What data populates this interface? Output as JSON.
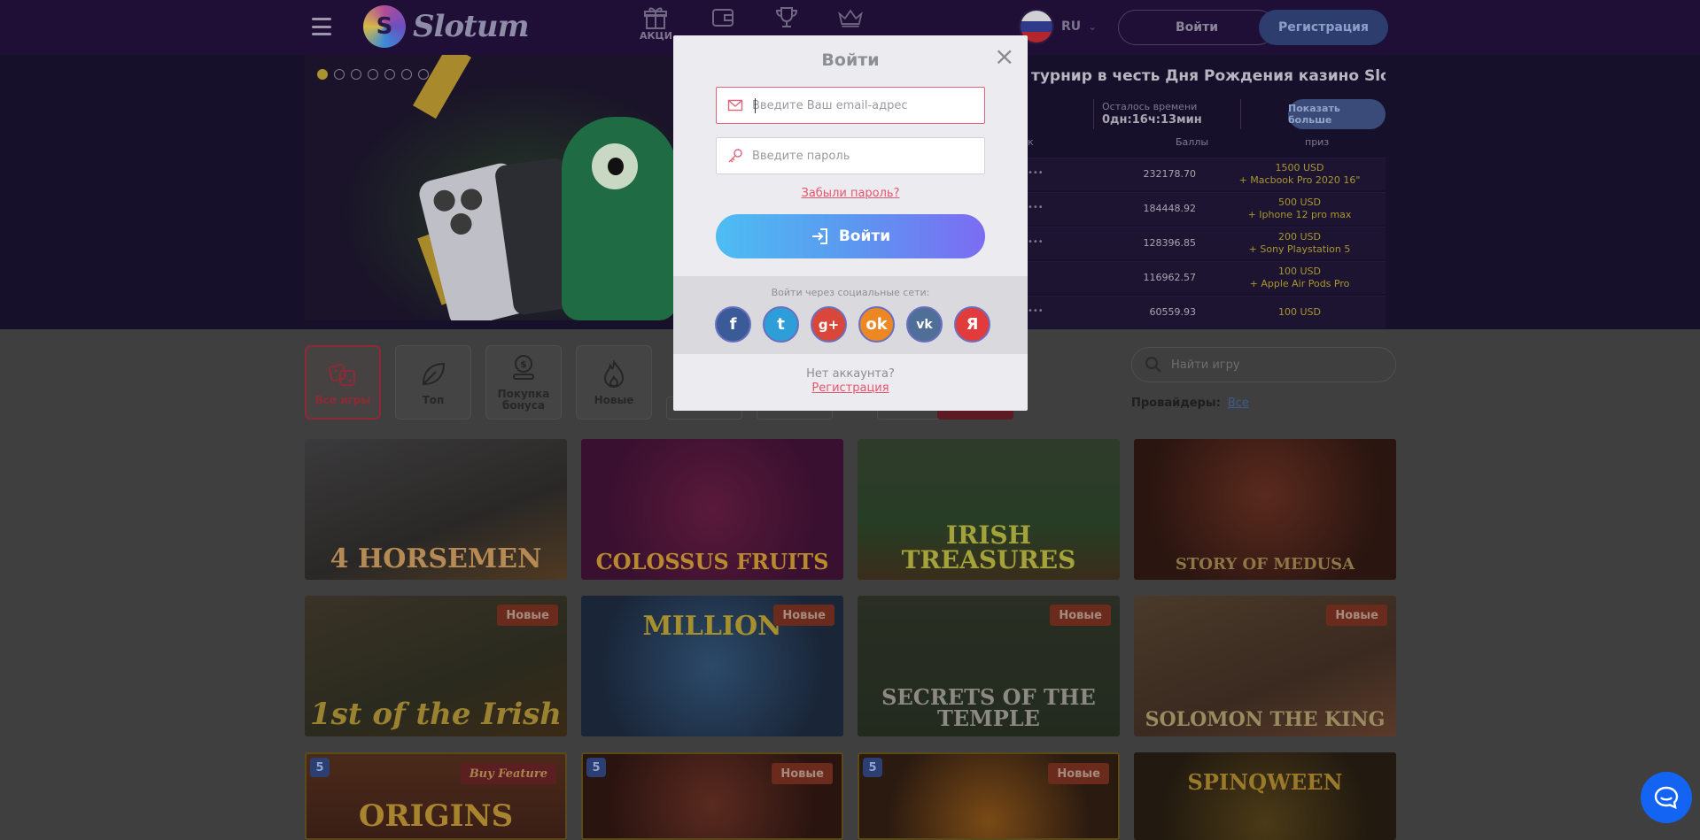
{
  "header": {
    "logo_text": "Slotum",
    "nav": [
      {
        "label": "АКЦИ",
        "icon": "gift-icon"
      },
      {
        "label": "",
        "icon": "wallet-icon"
      },
      {
        "label": "",
        "icon": "trophy-icon"
      },
      {
        "label": "",
        "icon": "crown-icon"
      }
    ],
    "lang": "RU",
    "login_label": "Войти",
    "register_label": "Регистрация"
  },
  "tournament": {
    "title": "вый турнир в честь Дня Рождения казино Slotum!",
    "time_label": "Осталось времени",
    "time_value": "0дн:16ч:13мин",
    "more_label": "Показать больше",
    "col_place": "к",
    "col_points": "Баллы",
    "col_prize": "приз",
    "rows": [
      {
        "player": "•••",
        "points": "232178.70",
        "prize": "1500 USD",
        "prize_extra": "+ Macbook Pro 2020 16\""
      },
      {
        "player": "•••",
        "points": "184448.92",
        "prize": "500 USD",
        "prize_extra": "+ Iphone 12 pro max"
      },
      {
        "player": "•••",
        "points": "128396.85",
        "prize": "200 USD",
        "prize_extra": "+ Sony Playstation 5"
      },
      {
        "player": "",
        "points": "116962.57",
        "prize": "100 USD",
        "prize_extra": "+ Apple Air Pods Pro"
      },
      {
        "player": "•••",
        "points": "60559.93",
        "prize": "100 USD",
        "prize_extra": ""
      }
    ]
  },
  "categories": [
    {
      "label": "Все игры",
      "icon": "dice-icon"
    },
    {
      "label": "Топ",
      "icon": "leaf-icon"
    },
    {
      "label": "Покупка бонуса",
      "icon": "coins-icon"
    },
    {
      "label": "Новые",
      "icon": "fire-icon"
    }
  ],
  "search": {
    "placeholder": "Найти игру"
  },
  "providers": {
    "label": "Провайдеры:",
    "value": "Все"
  },
  "games": [
    {
      "title": "4 HORSEMEN",
      "badge": ""
    },
    {
      "title": "COLOSSUS FRUITS",
      "badge": ""
    },
    {
      "title": "IRISH TREASURES",
      "badge": ""
    },
    {
      "title": "STORY OF MEDUSA",
      "badge": ""
    },
    {
      "title": "1st of the Irish",
      "badge": "Новые"
    },
    {
      "title": "MILLION",
      "badge": "Новые"
    },
    {
      "title": "SECRETS OF THE TEMPLE",
      "badge": "Новые"
    },
    {
      "title": "SOLOMON THE KING",
      "badge": "Новые"
    },
    {
      "title": "ORIGINS",
      "badge": "Buy Feature"
    },
    {
      "title": "",
      "badge": "Новые"
    },
    {
      "title": "",
      "badge": "Новые"
    },
    {
      "title": "SPINQWEEN",
      "badge": ""
    }
  ],
  "modal": {
    "title": "Войти",
    "email_placeholder": "Введите Ваш email-адрес",
    "password_placeholder": "Введите пароль",
    "forgot_label": "Забыли пароль?",
    "login_button": "Войти",
    "social_label": "Войти через социальные сети:",
    "socials": [
      {
        "name": "facebook",
        "glyph": "f"
      },
      {
        "name": "twitter",
        "glyph": "t"
      },
      {
        "name": "google-plus",
        "glyph": "g+"
      },
      {
        "name": "odnoklassniki",
        "glyph": "ok"
      },
      {
        "name": "vk",
        "glyph": "vk"
      },
      {
        "name": "yandex",
        "glyph": "Я"
      }
    ],
    "no_account": "Нет аккаунта?",
    "register_label": "Регистрация"
  },
  "colors": {
    "accent_pink": "#e2566e",
    "login_gradient_start": "#4dbdf2",
    "login_gradient_end": "#7c6cf2",
    "chat_blue": "#1464f4",
    "badge_new": "#6a2a1c"
  }
}
